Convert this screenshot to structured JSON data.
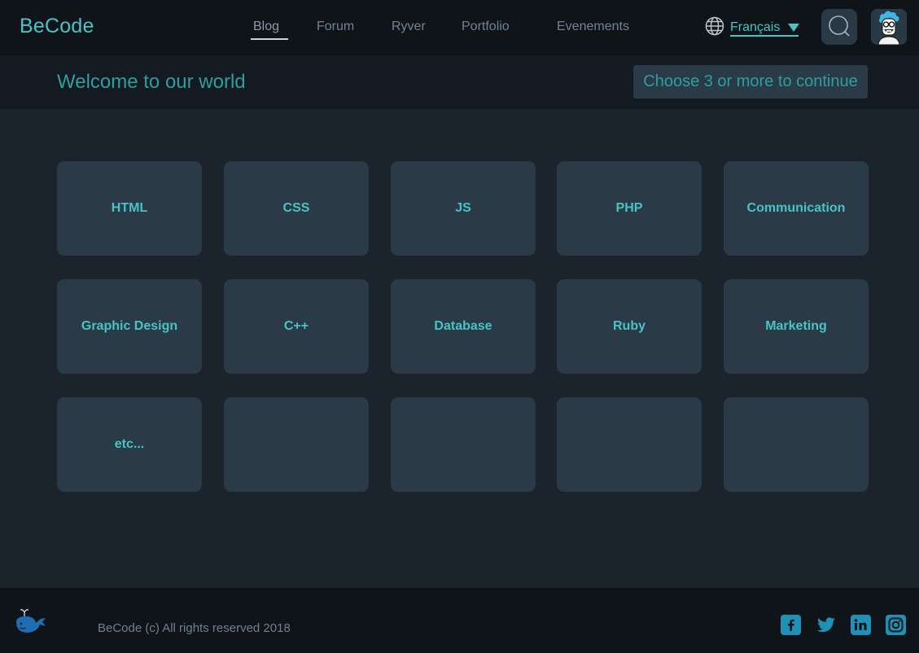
{
  "brand": {
    "name": "BeCode"
  },
  "nav": {
    "items": [
      "Blog",
      "Forum",
      "Ryver",
      "Portfolio",
      "Evenements"
    ],
    "active": "Blog",
    "language": "Français"
  },
  "banner": {
    "title": "Welcome to our world",
    "continue_label": "Choose 3 or more to continue"
  },
  "tiles": [
    "HTML",
    "CSS",
    "JS",
    "PHP",
    "Communication",
    "Graphic Design",
    "C++",
    "Database",
    "Ruby",
    "Marketing",
    "etc...",
    "",
    "",
    "",
    ""
  ],
  "footer": {
    "copyright": "BeCode (c) All rights reserved 2018",
    "social": [
      "facebook-icon",
      "twitter-icon",
      "linkedin-icon",
      "instagram-icon"
    ]
  },
  "colors": {
    "accent": "#48c3c6",
    "accent_dark": "#2e9ea2",
    "tile": "#2b3a47",
    "background": "#1b232d",
    "bar": "#0f1419",
    "social": "#1f90b6"
  }
}
